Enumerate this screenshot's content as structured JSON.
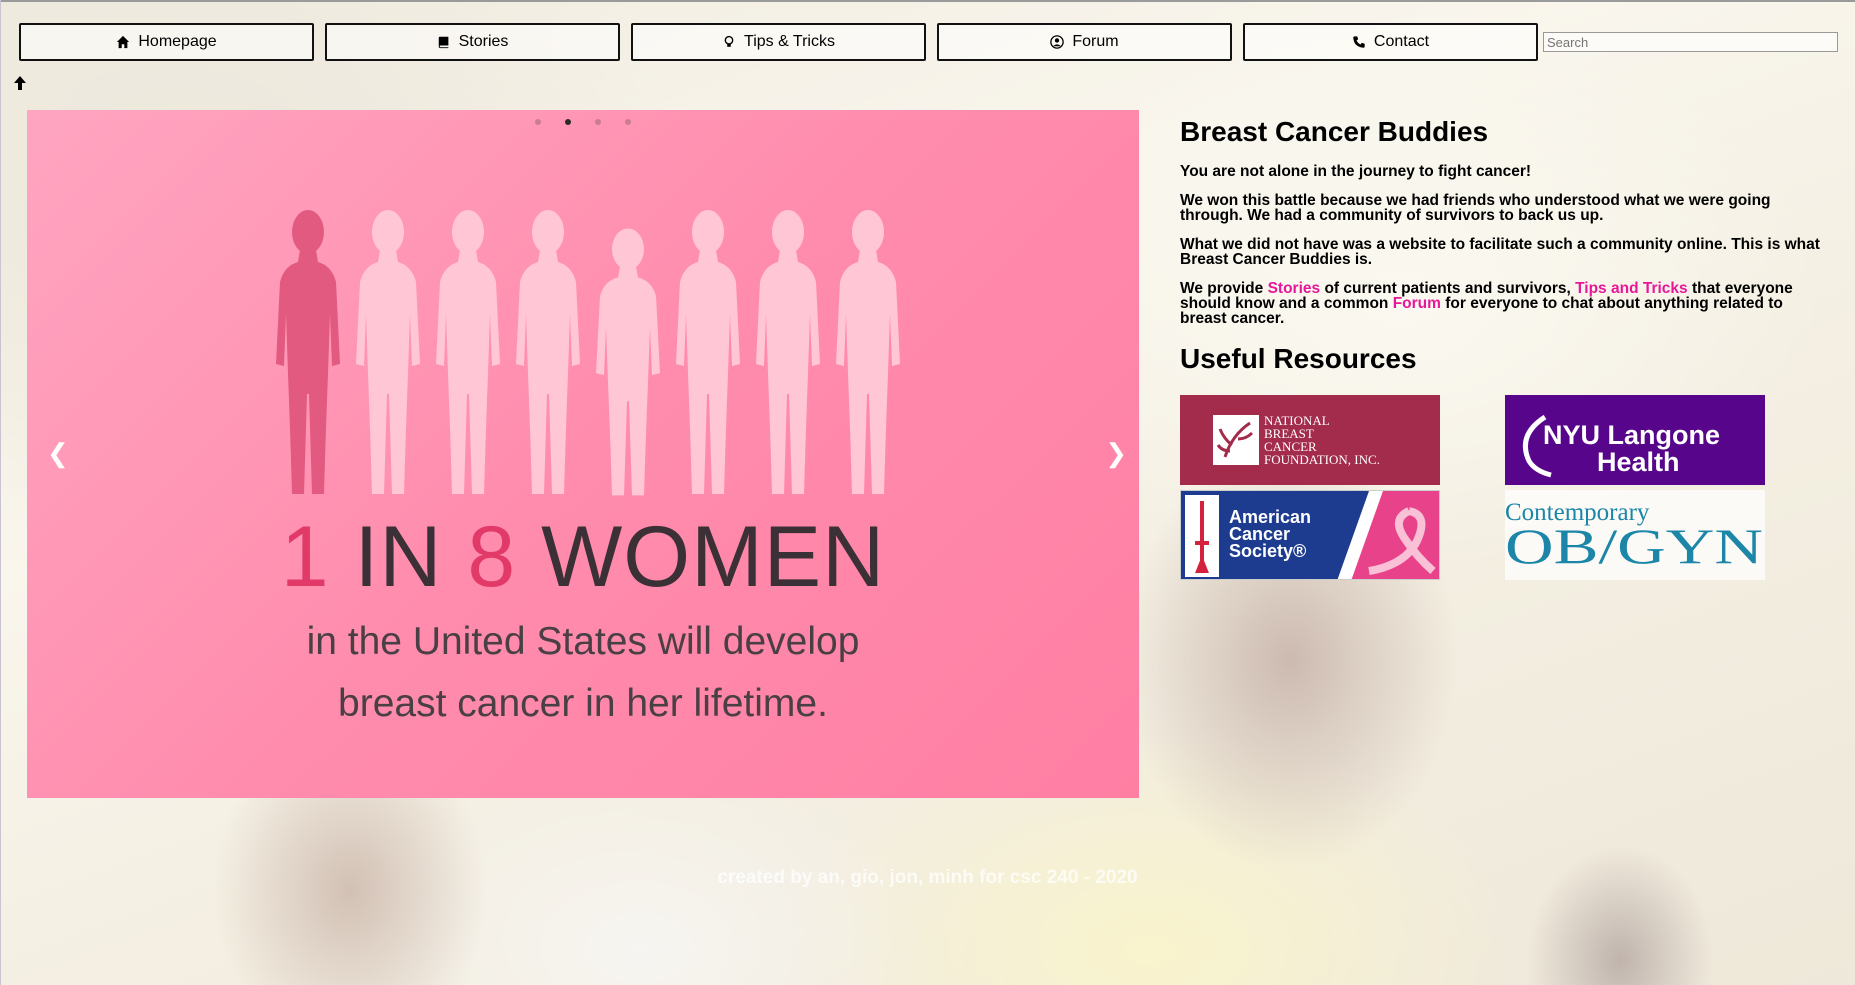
{
  "nav": {
    "items": [
      {
        "label": "Homepage",
        "icon": "home-icon"
      },
      {
        "label": "Stories",
        "icon": "book-icon"
      },
      {
        "label": "Tips & Tricks",
        "icon": "lightbulb-icon"
      },
      {
        "label": "Forum",
        "icon": "user-circle-icon"
      },
      {
        "label": "Contact",
        "icon": "phone-icon"
      }
    ],
    "search_placeholder": "Search"
  },
  "carousel": {
    "slide_count": 4,
    "active_slide": 2,
    "prev_label": "❮",
    "next_label": "❯",
    "headline_part1": "1",
    "headline_part2": " IN ",
    "headline_part3": "8",
    "headline_part4": " WOMEN",
    "subline1": "in the United States will develop",
    "subline2": "breast cancer in her lifetime.",
    "figures_total": 8,
    "figures_highlighted": 1
  },
  "about": {
    "title": "Breast Cancer Buddies",
    "p1": "You are not alone in the journey to fight cancer!",
    "p2": "We won this battle because we had friends who understood what we were going through. We had a community of survivors to back us up.",
    "p3": "What we did not have was a website to facilitate such a community online. This is what Breast Cancer Buddies is.",
    "p4_a": "We provide ",
    "p4_link1": "Stories",
    "p4_b": " of current patients and survivors, ",
    "p4_link2": "Tips and Tricks",
    "p4_c": " that everyone should know and a common ",
    "p4_link3": "Forum",
    "p4_d": " for everyone to chat about anything related to breast cancer."
  },
  "resources": {
    "title": "Useful Resources",
    "nbcf": [
      "NATIONAL",
      "BREAST",
      "CANCER",
      "FOUNDATION, INC."
    ],
    "nyu": [
      "NYU Langone",
      "Health"
    ],
    "acs": [
      "American",
      "Cancer",
      "Society®"
    ],
    "obgyn": [
      "Contemporary",
      "OB/GYN"
    ]
  },
  "footer": {
    "text": "created by an, gio, jon, minh for csc 240 - 2020"
  },
  "colors": {
    "accent_pink": "#e8179a",
    "slide_pink": "#ff8cad",
    "nbcf": "#a32b4b",
    "nyu": "#57068c",
    "acs_blue": "#1d3c8f",
    "obgyn_teal": "#1b86a8"
  }
}
